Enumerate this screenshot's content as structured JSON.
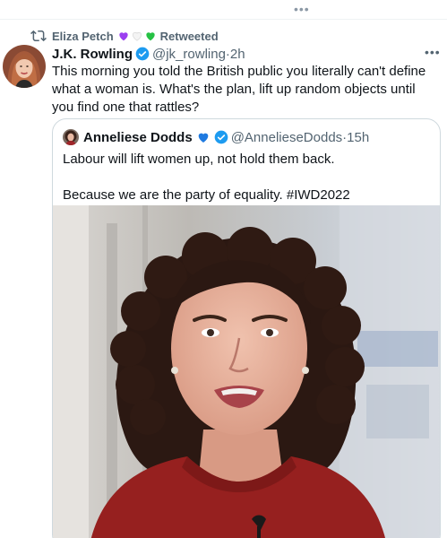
{
  "top": {
    "more_icon": "more-dots-icon"
  },
  "social_context": {
    "retweeter": "Eliza Petch",
    "hearts": [
      "#9b3ff0",
      "#f2f2f2",
      "#26c144"
    ],
    "action": "Retweeted"
  },
  "tweet": {
    "author_name": "J.K. Rowling",
    "handle": "@jk_rowling",
    "separator": "·",
    "time": "2h",
    "text": "This morning you told the British public you literally can't define what a woman is. What's the plan, lift up random objects until you find one that rattles?"
  },
  "quote": {
    "author_name": "Anneliese Dodds",
    "handle": "@AnnelieseDodds",
    "separator": "·",
    "time": "15h",
    "line1": "Labour will lift women up, not hold them back.",
    "line2": "Because we are the party of equality. #IWD2022"
  },
  "colors": {
    "accent": "#1d9bf0",
    "secondary_text": "#536471",
    "border": "#cfd9de"
  }
}
